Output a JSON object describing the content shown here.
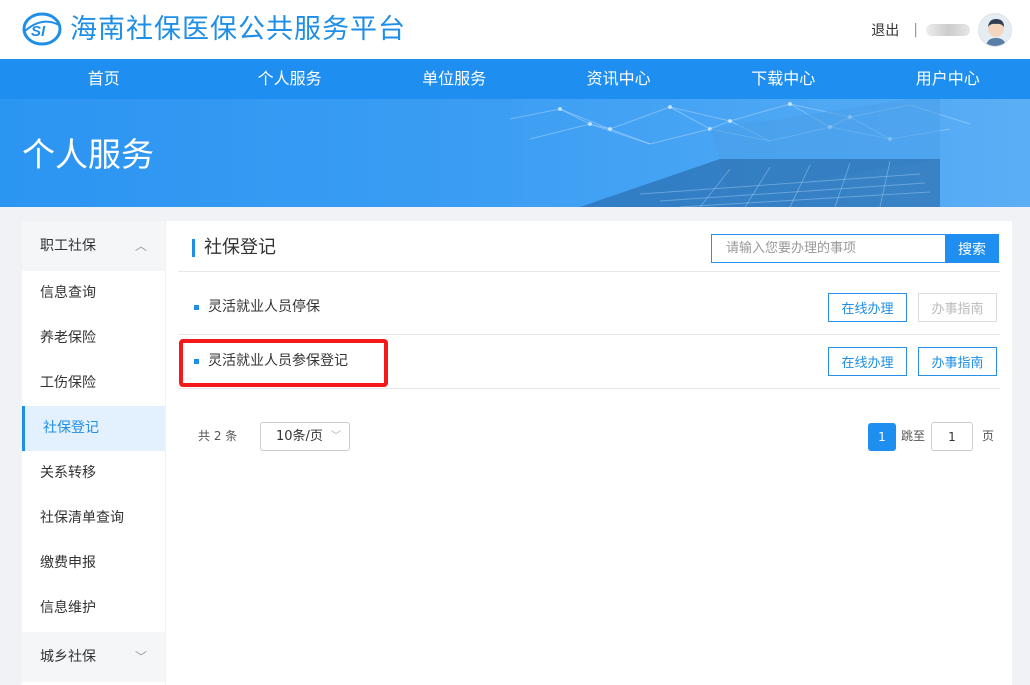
{
  "header": {
    "logo_text": "SI",
    "site_title": "海南社保医保公共服务平台",
    "logout_label": "退出",
    "separator": "|"
  },
  "nav": {
    "items": [
      "首页",
      "个人服务",
      "单位服务",
      "资讯中心",
      "下载中心",
      "用户中心"
    ]
  },
  "banner": {
    "title": "个人服务"
  },
  "sidebar": {
    "group_top": "职工社保",
    "items": [
      "信息查询",
      "养老保险",
      "工伤保险",
      "社保登记",
      "关系转移",
      "社保清单查询",
      "缴费申报",
      "信息维护"
    ],
    "active_item": "社保登记",
    "group_bottom": "城乡社保"
  },
  "main": {
    "title": "社保登记",
    "search_placeholder": "请输入您要办理的事项",
    "search_button": "搜索",
    "rows": [
      {
        "label": "灵活就业人员停保",
        "online_btn": "在线办理",
        "guide_btn": "办事指南",
        "guide_enabled": false
      },
      {
        "label": "灵活就业人员参保登记",
        "online_btn": "在线办理",
        "guide_btn": "办事指南",
        "guide_enabled": true
      }
    ],
    "pagination": {
      "total_text": "共 2 条",
      "page_size": "10条/页",
      "current_page": "1",
      "jump_label": "跳至",
      "jump_value": "1",
      "page_suffix": "页"
    }
  },
  "colors": {
    "primary": "#1e8ef0",
    "highlight": "#f4191b"
  }
}
